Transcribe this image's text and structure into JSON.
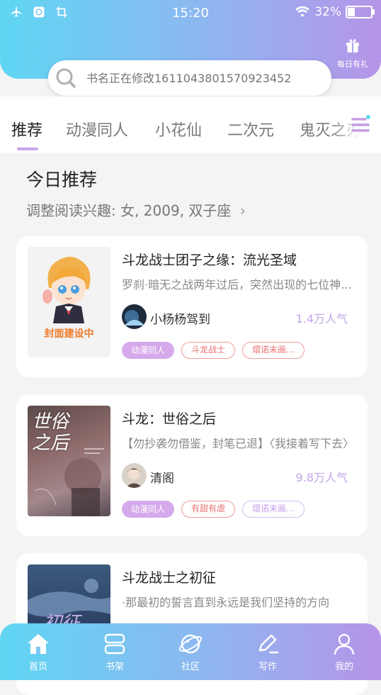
{
  "status_bar": {
    "time": "15:20",
    "battery": "32%",
    "battery_level": 0.32,
    "icons": [
      "airplane-icon",
      "vpn-icon",
      "crop-icon",
      "wifi-icon",
      "battery-icon"
    ]
  },
  "header": {
    "gift_label": "每日有礼",
    "search_placeholder": "书名正在修改1611043801570923452"
  },
  "tabs": [
    {
      "label": "推荐",
      "active": true
    },
    {
      "label": "动漫同人",
      "active": false
    },
    {
      "label": "小花仙",
      "active": false
    },
    {
      "label": "二次元",
      "active": false
    },
    {
      "label": "鬼灭之刃",
      "active": false
    }
  ],
  "section": {
    "title": "今日推荐",
    "subtitle": "调整阅读兴趣: 女, 2009, 双子座",
    "chevron": "›"
  },
  "books": [
    {
      "title": "斗龙战士团子之缘：流光圣域",
      "description": "罗刹·暗无之战两年过后，突然出现的七位神秘人",
      "author": "小杨杨驾到",
      "popularity": "1.4万人气",
      "cover_text": "封面建设中",
      "tags": [
        {
          "label": "动漫同人",
          "style": "purple"
        },
        {
          "label": "斗龙战士",
          "style": "red"
        },
        {
          "label": "熠诺末画…",
          "style": "red"
        }
      ]
    },
    {
      "title": "斗龙：世俗之后",
      "description": "【勿抄袭勿借鉴，封笔已退】〈我接着写下去〉",
      "author": "清阁",
      "popularity": "9.8万人气",
      "cover_text": "世俗之后",
      "tags": [
        {
          "label": "动漫同人",
          "style": "purple"
        },
        {
          "label": "有甜有虐",
          "style": "red"
        },
        {
          "label": "熠诺末画…",
          "style": "violet"
        }
      ]
    },
    {
      "title": "斗龙战士之初征",
      "description": "·那最初的誓言直到永远是我们坚持的方向",
      "cover_text": "初征"
    }
  ],
  "bottom_nav": [
    {
      "label": "首页",
      "icon": "home-icon"
    },
    {
      "label": "书架",
      "icon": "bookshelf-icon"
    },
    {
      "label": "社区",
      "icon": "planet-icon"
    },
    {
      "label": "写作",
      "icon": "pen-icon"
    },
    {
      "label": "我的",
      "icon": "user-icon"
    }
  ],
  "colors": {
    "gradient_start": "#5fd6f3",
    "gradient_end": "#b694e8",
    "accent_purple": "#c9a6ea",
    "tag_red": "#ea7373"
  }
}
